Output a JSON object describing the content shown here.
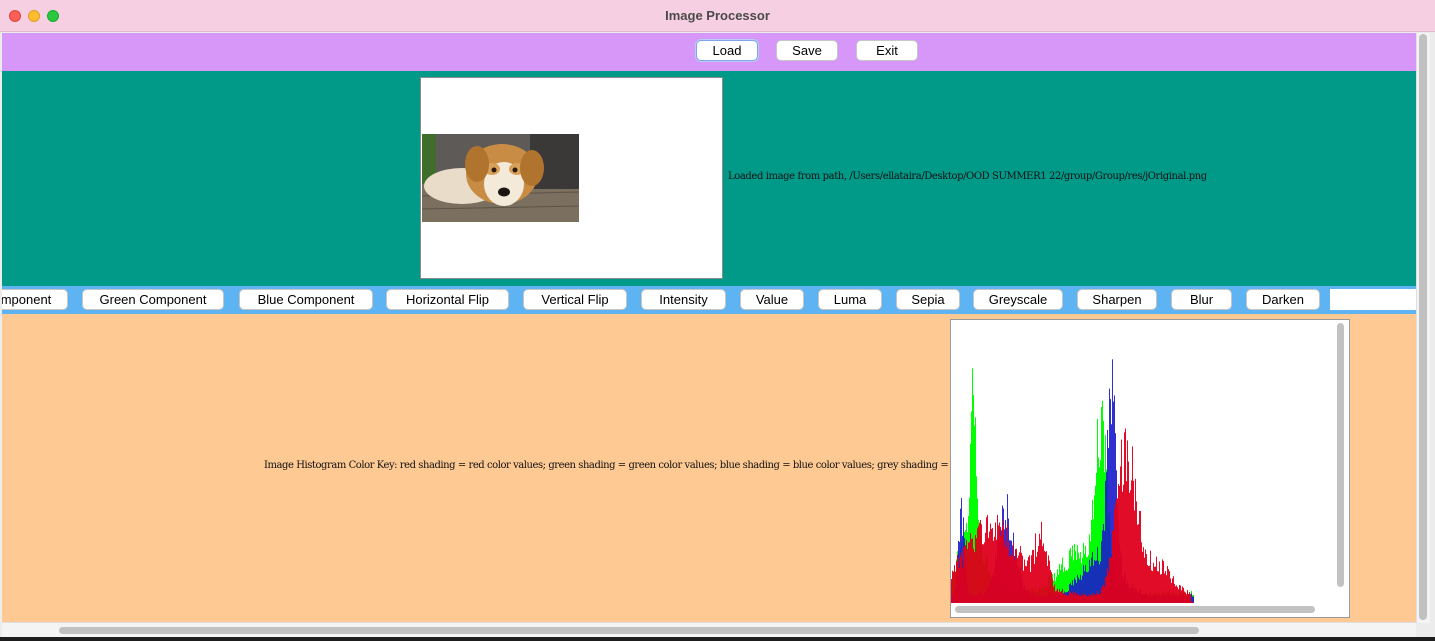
{
  "window": {
    "title": "Image Processor"
  },
  "toolbar": {
    "load_label": "Load",
    "save_label": "Save",
    "exit_label": "Exit"
  },
  "image_panel": {
    "status_text": "Loaded image from path, /Users/ellataira/Desktop/OOD SUMMER1 22/group/Group/res/jOriginal.png"
  },
  "operations": [
    {
      "label": "mponent",
      "name": "red-component-button"
    },
    {
      "label": "Green Component",
      "name": "green-component-button"
    },
    {
      "label": "Blue Component",
      "name": "blue-component-button"
    },
    {
      "label": "Horizontal Flip",
      "name": "horizontal-flip-button"
    },
    {
      "label": "Vertical Flip",
      "name": "vertical-flip-button"
    },
    {
      "label": "Intensity",
      "name": "intensity-button"
    },
    {
      "label": "Value",
      "name": "value-button"
    },
    {
      "label": "Luma",
      "name": "luma-button"
    },
    {
      "label": "Sepia",
      "name": "sepia-button"
    },
    {
      "label": "Greyscale",
      "name": "greyscale-button"
    },
    {
      "label": "Sharpen",
      "name": "sharpen-button"
    },
    {
      "label": "Blur",
      "name": "blur-button"
    },
    {
      "label": "Darken",
      "name": "darken-button"
    }
  ],
  "histogram_panel": {
    "key_text": "Image Histogram Color Key: red shading = red color values; green shading = green color values; blue shading = blue color values; grey shading = intensity values"
  },
  "colors": {
    "toolbar_bg": "#d697f9",
    "image_panel_bg": "#019a89",
    "ops_bar_bg": "#5eb3f3",
    "histogram_panel_bg": "#fec993",
    "red": "#e0001c",
    "green": "#00ff00",
    "blue": "#1a1acc"
  }
}
